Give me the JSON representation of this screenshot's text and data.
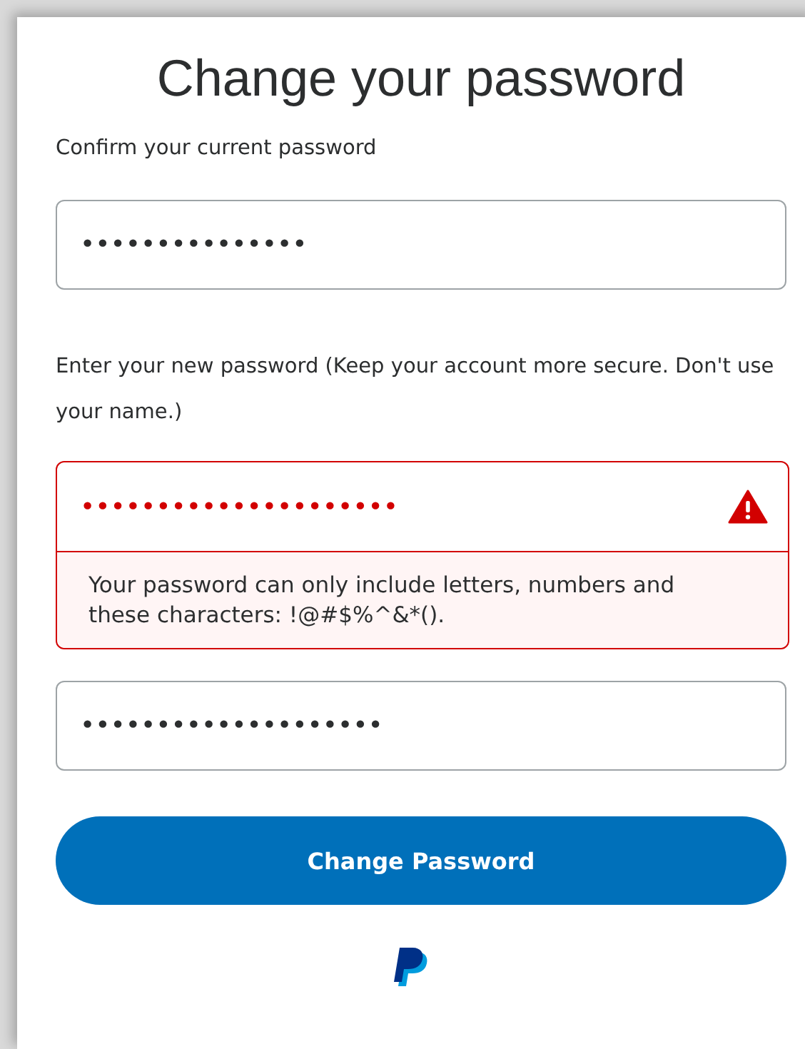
{
  "title": "Change your password",
  "sections": [
    {
      "label": "Confirm your current password",
      "fields": [
        {
          "value": "•••••••••••••••",
          "error": false
        }
      ]
    },
    {
      "label": "Enter your new password (Keep your account more secure. Don't use your name.)",
      "fields": [
        {
          "value": "•••••••••••••••••••••",
          "error": true,
          "message": "Your password can only include letters, numbers and these characters: !@#$%^&*()."
        },
        {
          "value": "••••••••••••••••••••",
          "error": false
        }
      ]
    }
  ],
  "button": "Change Password"
}
